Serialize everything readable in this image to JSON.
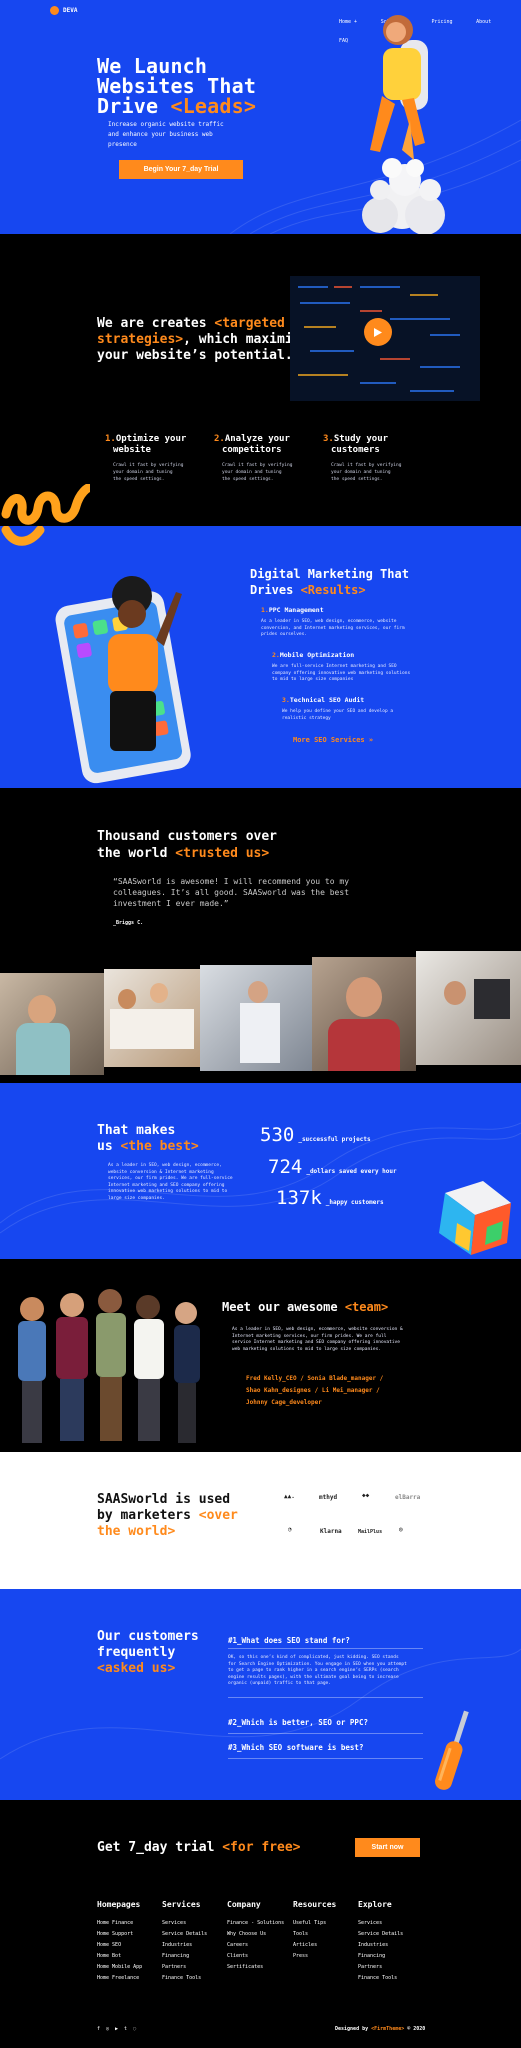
{
  "brand": {
    "name": "DEVA"
  },
  "nav": {
    "items": [
      "Home +",
      "Solutions",
      "Pricing",
      "About",
      "FAQ"
    ]
  },
  "hero": {
    "title_line1": "We Launch",
    "title_line2": "Websites That",
    "title_line3_plain": "Drive ",
    "title_line3_accent": "<Leads>",
    "subtitle_line1": "Increase organic website traffic",
    "subtitle_line2": "and enhance your business web",
    "subtitle_line3": "presence",
    "cta": "Begin Your 7_day Trial"
  },
  "intro": {
    "l1_plain": "We are creates ",
    "l1_accent": "<targeted SEO",
    "l2_accent": "strategies>",
    "l2_plain": ", which maximize",
    "l3": "your website’s potential."
  },
  "features": [
    {
      "num": "1.",
      "title1": "Optimize your",
      "title2": "website",
      "desc1": "Crawl it fast by verifying",
      "desc2": "your domain and tuning",
      "desc3": "the speed settings."
    },
    {
      "num": "2.",
      "title1": "Analyze your",
      "title2": "competitors",
      "desc1": "Crawl it fast by verifying",
      "desc2": "your domain and tuning",
      "desc3": "the speed settings."
    },
    {
      "num": "3.",
      "title1": "Study your",
      "title2": "customers",
      "desc1": "Crawl it fast by verifying",
      "desc2": "your domain and tuning",
      "desc3": "the speed settings."
    }
  ],
  "marketing": {
    "title_l1": "Digital Marketing That",
    "title_l2_plain": "Drives ",
    "title_l2_accent": "<Results>",
    "items": [
      {
        "num": "1.",
        "title": "PPC Management",
        "d1": "As a leader in SEO, web design, ecommerce, website",
        "d2": "conversion, and Internet marketing services, our firm",
        "d3": "prides ourselves."
      },
      {
        "num": "2.",
        "title": "Mobile Optimization",
        "d1": "We are full-service Internet marketing and SEO",
        "d2": "company offering innovative web marketing solutions",
        "d3": "to mid to large size companies"
      },
      {
        "num": "3.",
        "title": "Technical SEO Audit",
        "d1": "We help you define your SEO and develop a",
        "d2": "realistic strategy",
        "d3": ""
      }
    ],
    "link": "More SEO Services »"
  },
  "testimonial": {
    "title_l1": "Thousand customers over",
    "title_l2_plain": "the world ",
    "title_l2_accent": "<trusted us>",
    "quote_l1": "“SAASworld is awesome! I will recommend you to my",
    "quote_l2": "colleagues. It’s all good. SAASworld was the best",
    "quote_l3": "investment I ever made.”",
    "author": "_Briggs C."
  },
  "stats": {
    "title_l1": "That makes",
    "title_l2_plain": "us ",
    "title_l2_accent": "<the best>",
    "d1": "As a leader in SEO, web design, ecommerce,",
    "d2": "website conversion & Internet marketing",
    "d3": "services, our firm prides. We are full-service",
    "d4": "Internet marketing and SEO company offering",
    "d5": "innovative web marketing solutions to mid to",
    "d6": "large size companies.",
    "items": [
      {
        "value": "530",
        "label": "_successful projects"
      },
      {
        "value": "724",
        "label": "_dollars saved every hour"
      },
      {
        "value": "137k",
        "label": "_happy customers"
      }
    ]
  },
  "team": {
    "title_plain": "Meet our awesome ",
    "title_accent": "<team>",
    "d1": "As a leader in SEO, web design, ecommerce, website conversion &",
    "d2": "Internet marketing services, our firm prides. We are full",
    "d3": "service Internet marketing and SEO company offering innovative",
    "d4": "web marketing solutions to mid to large size companies.",
    "m1": "Fred Kelly_CEO",
    "m2": "Sonia Blade_manager",
    "m3": "Shao Kahn_designes",
    "m4": "Li Mei_manager",
    "m5": "Johnny Cage_developer"
  },
  "clients": {
    "title_l1": "SAASworld is used",
    "title_l2_plain": "by marketers ",
    "title_l2_accent": "<over",
    "title_l3_accent": "the world>",
    "logos": [
      "▲▲.",
      "mthyd",
      "◆◆",
      "elBarra",
      "◔",
      "Klarna",
      "MailPlus",
      "◎"
    ]
  },
  "faq": {
    "title_l1": "Our customers",
    "title_l2": "frequently",
    "title_l3": "<asked us>",
    "q1": "#1_What does SEO stand for?",
    "a1_l1": "OK, so this one’s kind of complicated, just kidding. SEO stands",
    "a1_l2": "for Search Engine Optimization. You engage in SEO when you attempt",
    "a1_l3": "to get a page to rank higher in a search engine’s SERPs (search",
    "a1_l4": "engine results pages), with the ultimate goal being to increase",
    "a1_l5": "organic (unpaid) traffic to that page.",
    "q2": "#2_Which is better, SEO or PPC?",
    "q3": "#3_Which SEO software is best?"
  },
  "cta": {
    "title_plain": "Get 7_day trial ",
    "title_accent": "<for free>",
    "button": "Start now"
  },
  "footer": {
    "cols": [
      {
        "title": "Homepages",
        "links": [
          "Home Finance",
          "Home Support",
          "Home SEO",
          "Home Bot",
          "Home Mobile App",
          "Home Freelance"
        ]
      },
      {
        "title": "Services",
        "links": [
          "Services",
          "Service Details",
          "Industries",
          "Financing",
          "Partners",
          "Finance Tools"
        ]
      },
      {
        "title": "Company",
        "links": [
          "Finance - Solutions",
          "Why Choose Us",
          "Careers",
          "Clients",
          "Sertificates"
        ]
      },
      {
        "title": "Resources",
        "links": [
          "Useful Tips",
          "Tools",
          "Articles",
          "Press"
        ]
      },
      {
        "title": "Explore",
        "links": [
          "Services",
          "Service Details",
          "Industries",
          "Financing",
          "Partners",
          "Finance Tools"
        ]
      }
    ],
    "credit_plain": "Designed by ",
    "credit_accent": "<FirmTheme>",
    "credit_year": " © 2020",
    "social": [
      "f",
      "◎",
      "▶",
      "t",
      "◌"
    ]
  },
  "colors": {
    "blue": "#1747f0",
    "orange": "#ff8a1c",
    "black": "#000000"
  }
}
